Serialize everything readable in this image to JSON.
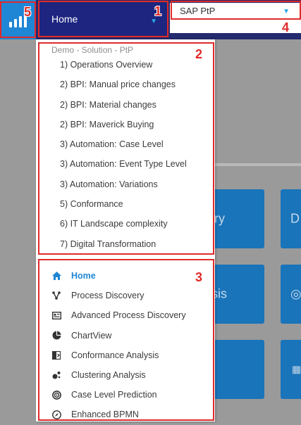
{
  "topbar": {
    "home_label": "Home",
    "dataset_label": "SAP PtP"
  },
  "menu": {
    "section_title": "Demo - Solution - PtP",
    "dashboards": [
      {
        "label": "1) Operations Overview"
      },
      {
        "label": "2) BPI: Manual price changes"
      },
      {
        "label": "2) BPI: Material changes"
      },
      {
        "label": "2) BPI: Maverick Buying"
      },
      {
        "label": "3) Automation: Case Level"
      },
      {
        "label": "3) Automation: Event Type Level"
      },
      {
        "label": "3) Automation: Variations"
      },
      {
        "label": "5) Conformance"
      },
      {
        "label": "6) IT Landscape complexity"
      },
      {
        "label": "7) Digital Transformation"
      }
    ],
    "pages": [
      {
        "label": "Home",
        "icon": "home-icon",
        "active": true
      },
      {
        "label": "Process Discovery",
        "icon": "process-discovery-icon"
      },
      {
        "label": "Advanced Process Discovery",
        "icon": "advanced-discovery-icon"
      },
      {
        "label": "ChartView",
        "icon": "pie-chart-icon"
      },
      {
        "label": "Conformance Analysis",
        "icon": "conformance-icon"
      },
      {
        "label": "Clustering Analysis",
        "icon": "clustering-icon"
      },
      {
        "label": "Case Level Prediction",
        "icon": "prediction-icon"
      },
      {
        "label": "Enhanced BPMN",
        "icon": "compass-icon"
      }
    ]
  },
  "background_tiles": {
    "tile_a_text": "ry",
    "tile_b_text": "D",
    "tile_c_text": "sis"
  },
  "annotations": {
    "n1": "1",
    "n2": "2",
    "n3": "3",
    "n4": "4",
    "n5": "5"
  },
  "colors": {
    "topbar": "#232a6e",
    "accent": "#1f86d6",
    "annotation": "#e02a2a"
  }
}
